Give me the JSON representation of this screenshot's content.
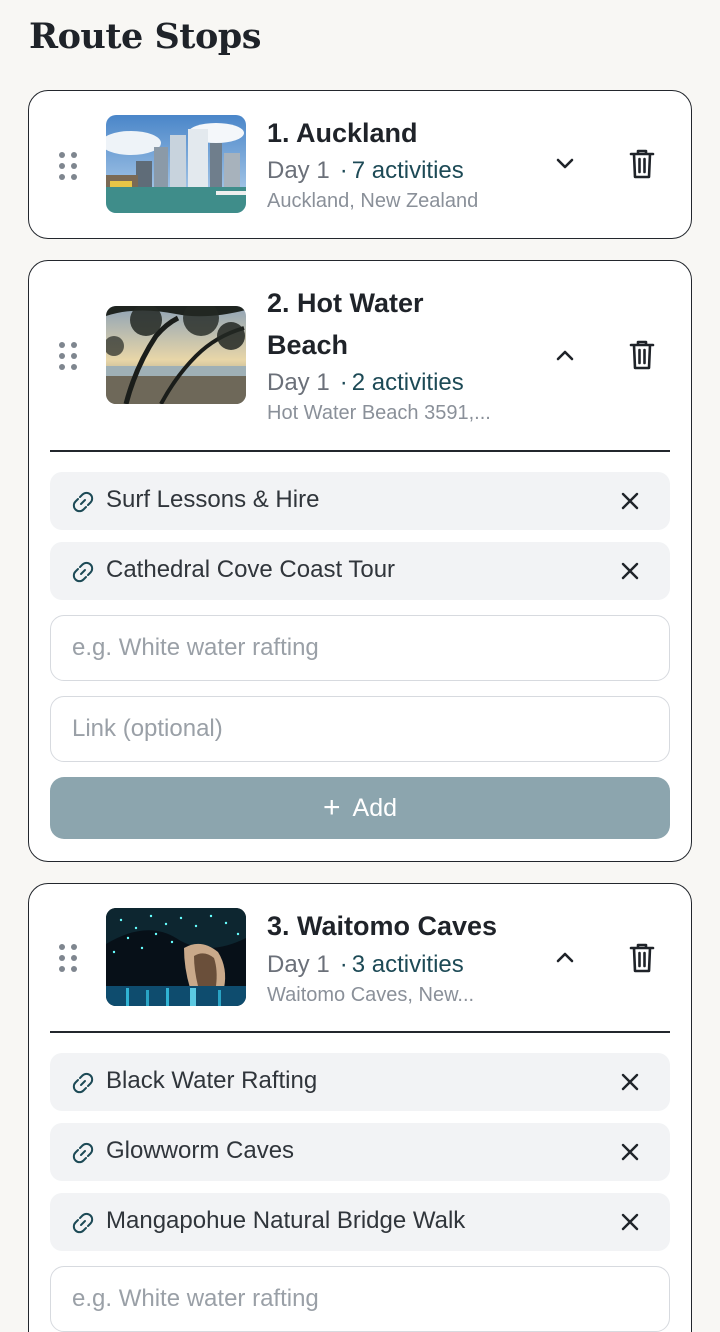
{
  "page": {
    "title": "Route Stops"
  },
  "stops": [
    {
      "title": "1. Auckland",
      "day": "Day 1",
      "activities_count": "7 activities",
      "location": "Auckland, New Zealand",
      "expanded": false,
      "thumb_icon": "city-skyline-photo"
    },
    {
      "title_line1": "2. Hot Water",
      "title_line2": "Beach",
      "day": "Day 1",
      "activities_count": "2 activities",
      "location": "Hot Water Beach 3591,...",
      "expanded": true,
      "thumb_icon": "beach-trees-photo",
      "activities": [
        {
          "label": "Surf Lessons & Hire"
        },
        {
          "label": "Cathedral Cove Coast Tour"
        }
      ],
      "form": {
        "activity_placeholder": "e.g. White water rafting",
        "link_placeholder": "Link (optional)",
        "add_label": "Add"
      }
    },
    {
      "title": "3. Waitomo Caves",
      "day": "Day 1",
      "activities_count": "3 activities",
      "location": "Waitomo Caves, New...",
      "expanded": true,
      "thumb_icon": "glowworm-cave-photo",
      "activities": [
        {
          "label": "Black Water Rafting"
        },
        {
          "label": "Glowworm Caves"
        },
        {
          "label": "Mangapohue Natural Bridge Walk"
        }
      ],
      "form": {
        "activity_placeholder": "e.g. White water rafting"
      }
    }
  ],
  "meta_separator": "·",
  "colors": {
    "accent": "#1d4a56",
    "add_button": "#8ca5ae",
    "background": "#f8f7f4"
  }
}
